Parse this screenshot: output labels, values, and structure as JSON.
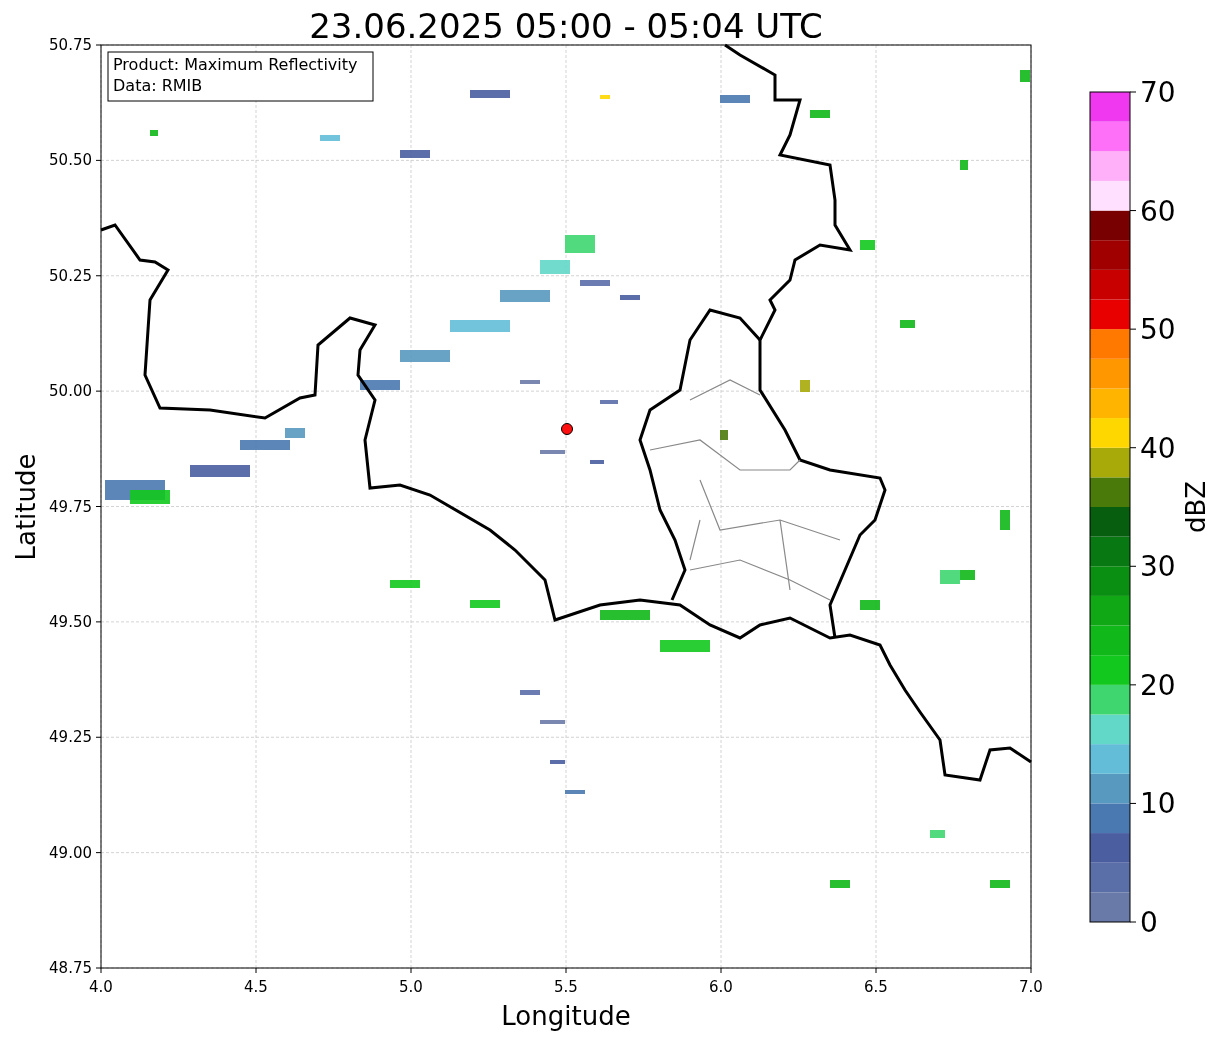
{
  "title": "23.06.2025 05:00 - 05:04 UTC",
  "legend": [
    "Product: Maximum Reflectivity",
    "Data: RMIB"
  ],
  "x_axis": {
    "label": "Longitude",
    "ticks": [
      "4.0",
      "4.5",
      "5.0",
      "5.5",
      "6.0",
      "6.5",
      "7.0"
    ]
  },
  "y_axis": {
    "label": "Latitude",
    "ticks": [
      "50.75",
      "50.50",
      "50.25",
      "50.00",
      "49.75",
      "49.50",
      "49.25",
      "49.00",
      "48.75"
    ]
  },
  "colorbar": {
    "label": "dBZ",
    "ticks": [
      "70",
      "60",
      "50",
      "40",
      "30",
      "20",
      "10",
      "0"
    ],
    "bands": [
      {
        "color": "#6a7aa8"
      },
      {
        "color": "#5a6ea8"
      },
      {
        "color": "#4a5ea0"
      },
      {
        "color": "#4a78b0"
      },
      {
        "color": "#5899c0"
      },
      {
        "color": "#63bcd8"
      },
      {
        "color": "#62d8c8"
      },
      {
        "color": "#3fd670"
      },
      {
        "color": "#12c81e"
      },
      {
        "color": "#10b81a"
      },
      {
        "color": "#10a815"
      },
      {
        "color": "#0b8f12"
      },
      {
        "color": "#087812"
      },
      {
        "color": "#065e0e"
      },
      {
        "color": "#4a7a0a"
      },
      {
        "color": "#a8aa0a"
      },
      {
        "color": "#ffd700"
      },
      {
        "color": "#ffb400"
      },
      {
        "color": "#ff9800"
      },
      {
        "color": "#ff7800"
      },
      {
        "color": "#e80000"
      },
      {
        "color": "#c80000"
      },
      {
        "color": "#a00000"
      },
      {
        "color": "#780000"
      },
      {
        "color": "#ffe0ff"
      },
      {
        "color": "#ffb0f8"
      },
      {
        "color": "#ff70f8"
      },
      {
        "color": "#f038f0"
      }
    ]
  }
}
